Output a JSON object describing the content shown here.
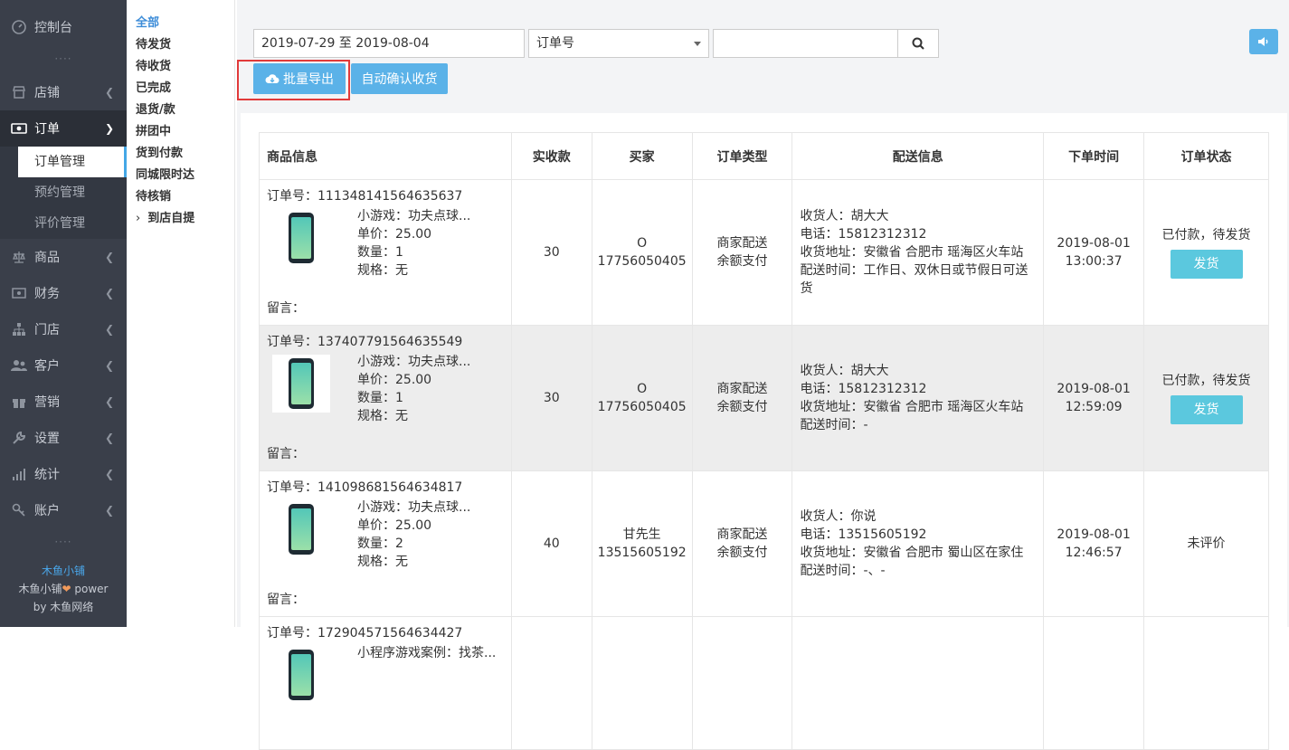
{
  "sidebar": {
    "items": [
      {
        "label": "控制台",
        "icon": "dashboard-icon"
      },
      {
        "label": "店铺",
        "icon": "store-icon"
      },
      {
        "label": "订单",
        "icon": "order-icon"
      },
      {
        "label": "商品",
        "icon": "scale-icon"
      },
      {
        "label": "财务",
        "icon": "money-icon"
      },
      {
        "label": "门店",
        "icon": "sitemap-icon"
      },
      {
        "label": "客户",
        "icon": "users-icon"
      },
      {
        "label": "营销",
        "icon": "gift-icon"
      },
      {
        "label": "设置",
        "icon": "wrench-icon"
      },
      {
        "label": "统计",
        "icon": "chart-icon"
      },
      {
        "label": "账户",
        "icon": "key-icon"
      }
    ],
    "order_sub": [
      "订单管理",
      "预约管理",
      "评价管理"
    ],
    "footer": {
      "brand": "木鱼小铺",
      "line2a": "木鱼小铺",
      "line2b": " power",
      "line3": "by 木鱼网络"
    }
  },
  "subnav": [
    "全部",
    "待发货",
    "待收货",
    "已完成",
    "退货/款",
    "拼团中",
    "货到付款",
    "同城限时达",
    "待核销",
    "到店自提"
  ],
  "toolbar": {
    "date_range": "2019-07-29 至 2019-08-04",
    "select_value": "订单号",
    "search_value": "",
    "export_label": "批量导出",
    "auto_confirm_label": "自动确认收货"
  },
  "table": {
    "headers": [
      "商品信息",
      "实收款",
      "买家",
      "订单类型",
      "配送信息",
      "下单时间",
      "订单状态"
    ],
    "rows": [
      {
        "order_no": "订单号：111348141564635637",
        "title": "小游戏：功夫点球...",
        "price": "单价：25.00",
        "qty": "数量：1",
        "spec": "规格：无",
        "msg": "留言：",
        "amount": "30",
        "buyer1": "O",
        "buyer2": "17756050405",
        "type1": "商家配送",
        "type2": "余额支付",
        "recv": "收货人：胡大大",
        "phone": "电话：15812312312",
        "addr": "收货地址：安徽省 合肥市 瑶海区火车站",
        "time_d": "配送时间：工作日、双休日或节假日可送货",
        "date": "2019-08-01",
        "clock": "13:00:37",
        "status": "已付款，待发货",
        "action": "发货"
      },
      {
        "order_no": "订单号：137407791564635549",
        "title": "小游戏：功夫点球...",
        "price": "单价：25.00",
        "qty": "数量：1",
        "spec": "规格：无",
        "msg": "留言：",
        "amount": "30",
        "buyer1": "O",
        "buyer2": "17756050405",
        "type1": "商家配送",
        "type2": "余额支付",
        "recv": "收货人：胡大大",
        "phone": "电话：15812312312",
        "addr": "收货地址：安徽省 合肥市 瑶海区火车站",
        "time_d": "配送时间：-",
        "date": "2019-08-01",
        "clock": "12:59:09",
        "status": "已付款，待发货",
        "action": "发货"
      },
      {
        "order_no": "订单号：141098681564634817",
        "title": "小游戏：功夫点球...",
        "price": "单价：25.00",
        "qty": "数量：2",
        "spec": "规格：无",
        "msg": "留言：",
        "amount": "40",
        "buyer1": "甘先生",
        "buyer2": "13515605192",
        "type1": "商家配送",
        "type2": "余额支付",
        "recv": "收货人：你说",
        "phone": "电话：13515605192",
        "addr": "收货地址：安徽省 合肥市 蜀山区在家住",
        "time_d": "配送时间：-、-",
        "date": "2019-08-01",
        "clock": "12:46:57",
        "status": "未评价",
        "action": ""
      },
      {
        "order_no": "订单号：172904571564634427",
        "title": "小程序游戏案例：找茶..."
      }
    ]
  }
}
